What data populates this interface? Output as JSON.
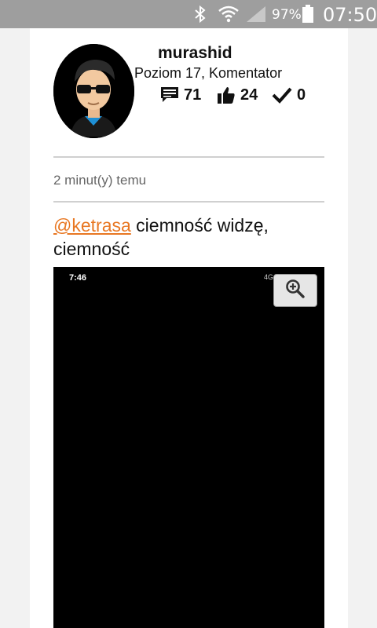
{
  "status_bar": {
    "battery_percent": "97%",
    "clock": "07:50",
    "icons": [
      "bluetooth-icon",
      "wifi-icon",
      "signal-icon",
      "battery-icon"
    ]
  },
  "profile": {
    "username": "murashid",
    "level_text": "Poziom 17, Komentator",
    "stats": {
      "comments": "71",
      "likes": "24",
      "accepted": "0"
    }
  },
  "post": {
    "timestamp": "2 minut(y) temu",
    "mention": "@ketrasa",
    "text": " ciemność widzę, ciemność"
  },
  "attachment": {
    "screenshot_time": "7:46",
    "screenshot_status": "4G",
    "zoom_icon": "zoom-in-icon"
  },
  "colors": {
    "status_bar_bg": "#9e9e9e",
    "mention": "#e87722",
    "divider": "#d0d0d0"
  }
}
